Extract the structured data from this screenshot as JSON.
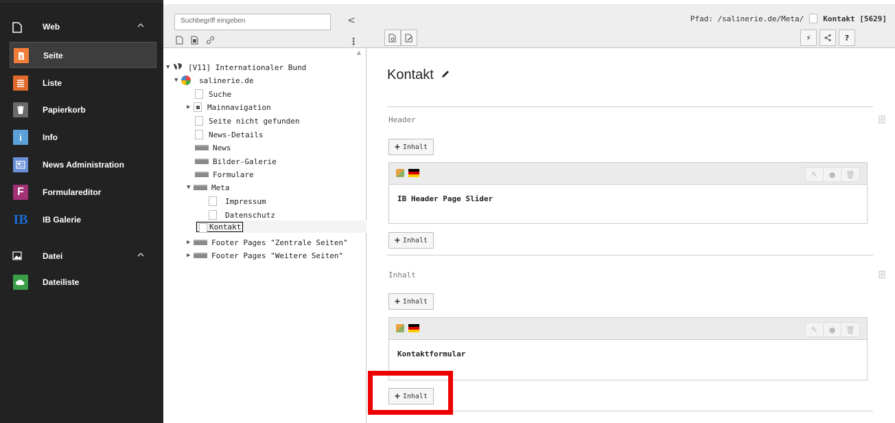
{
  "module_menu": {
    "groups": [
      {
        "label": "Web",
        "icon": "page-outline-icon",
        "chevron": "^"
      },
      {
        "label": "Datei",
        "icon": "image-icon",
        "chevron": "^"
      }
    ],
    "items": [
      {
        "label": "Seite",
        "icon": "page-icon",
        "color": "#f07e38",
        "active": true
      },
      {
        "label": "Liste",
        "icon": "list-icon",
        "color": "#e06a2c"
      },
      {
        "label": "Papierkorb",
        "icon": "trash-icon",
        "color": "#6a6a6a"
      },
      {
        "label": "Info",
        "icon": "info-icon",
        "color": "#5ba0d8"
      },
      {
        "label": "News Administration",
        "icon": "newspaper-icon",
        "color": "#6b8fd6"
      },
      {
        "label": "Formulareditor",
        "icon": "form-f-icon",
        "color": "#a43076"
      },
      {
        "label": "IB Galerie",
        "icon": "ib-logo-icon",
        "color": "#1a6ad2"
      },
      {
        "label": "Dateiliste",
        "icon": "cloud-file-icon",
        "color": "#3a9f48"
      }
    ]
  },
  "tree": {
    "search_placeholder": "Suchbegriff eingeben",
    "collapse_icon": "<",
    "root": "[V11] Internationaler Bund",
    "site": "salinerie.de",
    "nodes": [
      {
        "label": "Suche"
      },
      {
        "label": "Mainnavigation"
      },
      {
        "label": "Seite nicht gefunden"
      },
      {
        "label": "News-Details"
      },
      {
        "label": "News"
      },
      {
        "label": "Bilder-Galerie"
      },
      {
        "label": "Formulare"
      },
      {
        "label": "Meta"
      },
      {
        "label": "Impressum"
      },
      {
        "label": "Datenschutz"
      },
      {
        "label": "Kontakt"
      },
      {
        "label": "Footer Pages \"Zentrale Seiten\""
      },
      {
        "label": "Footer Pages \"Weitere Seiten\""
      }
    ]
  },
  "main": {
    "path_prefix": "Pfad: /salinerie.de/Meta/",
    "path_current": "Kontakt [5629]",
    "page_title": "Kontakt",
    "sections": [
      {
        "label": "Header",
        "element_title": "IB Header Page Slider"
      },
      {
        "label": "Inhalt",
        "element_title": "Kontaktformular"
      }
    ],
    "add_button_label": "Inhalt",
    "toolbar_right": [
      "⚡",
      "<",
      "?"
    ]
  }
}
